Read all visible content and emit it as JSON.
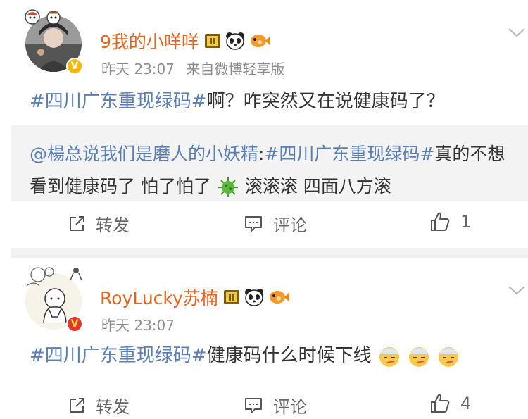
{
  "posts": [
    {
      "username": "9我的小咩咩",
      "time": "昨天 23:07",
      "source": "来自微博轻享版",
      "hashtag": "#四川广东重现绿码#",
      "text": "啊？咋突然又在说健康码了？",
      "repost": {
        "mention": "@楊总说我们是磨人的小妖精",
        "colon": ":",
        "hashtag": "#四川广东重现绿码#",
        "text_a": "真的不想看到健康码了 怕了怕了 ",
        "text_b": " 滚滚滚 四面八方滚"
      },
      "actions": {
        "repost": "转发",
        "comment": "评论",
        "like_count": "1"
      }
    },
    {
      "username": "RoyLucky苏楠",
      "time": "昨天 23:07",
      "hashtag": "#四川广东重现绿码#",
      "text": "健康码什么时候下线",
      "actions": {
        "repost": "转发",
        "comment": "评论",
        "like_count": "4"
      }
    }
  ],
  "colors": {
    "username": "#e8641b",
    "link": "#5a7fb5",
    "meta": "#8d8d8d",
    "repost_bg": "#f3f3f3",
    "verified_gold": "#f5b700",
    "verified_red": "#e0362b"
  },
  "icons": [
    "chevron-down-icon",
    "share-icon",
    "comment-icon",
    "thumbs-up-icon",
    "virus-emoji",
    "panda-icon",
    "fish-icon",
    "vip-badge-icon",
    "verified-icon",
    "sick-face-emoji"
  ]
}
